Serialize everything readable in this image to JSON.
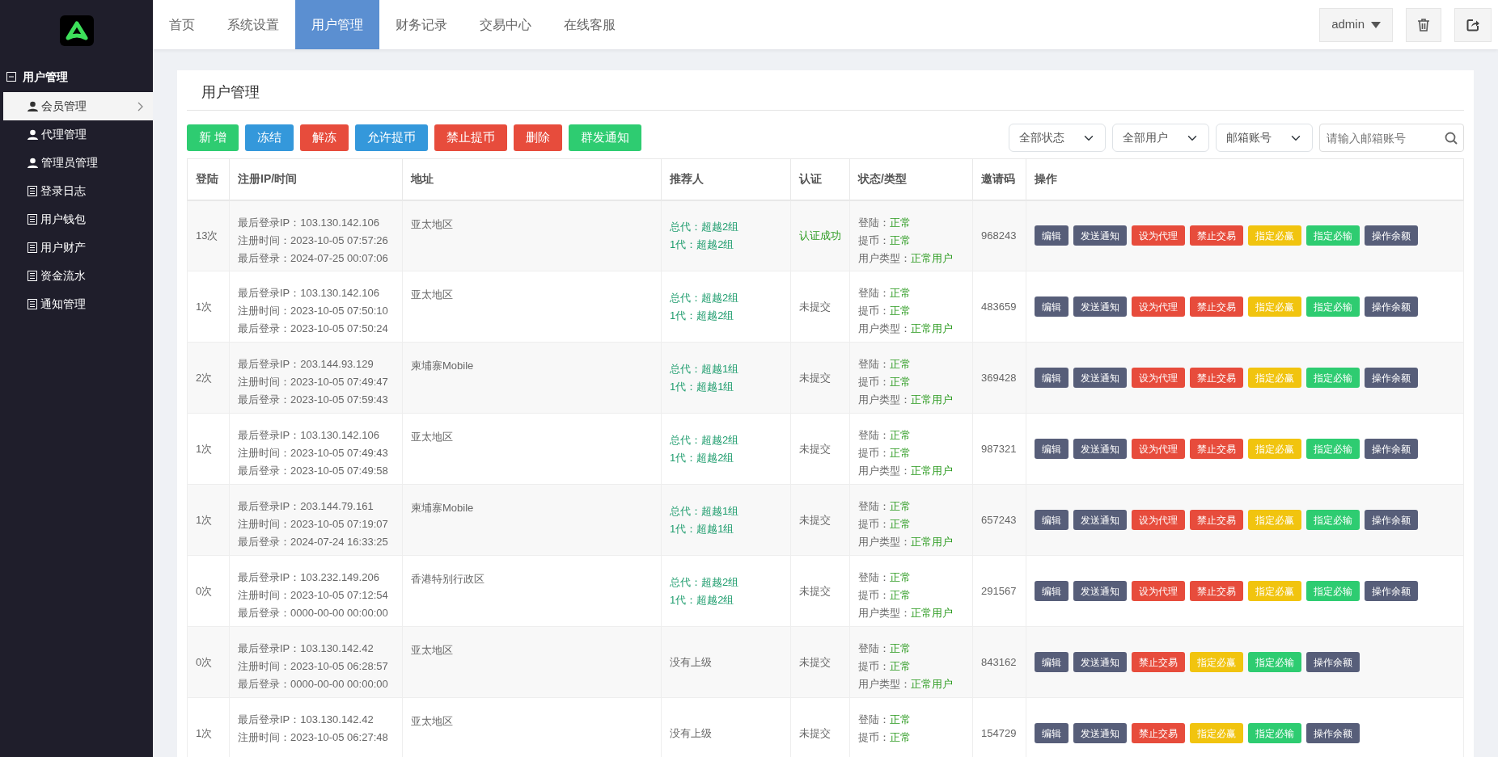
{
  "sidebar": {
    "group": {
      "label": "用户管理",
      "expanded": true
    },
    "items": [
      {
        "label": "会员管理",
        "kind": "user",
        "selected": true
      },
      {
        "label": "代理管理",
        "kind": "user",
        "selected": false
      },
      {
        "label": "管理员管理",
        "kind": "user",
        "selected": false
      },
      {
        "label": "登录日志",
        "kind": "list",
        "selected": false
      },
      {
        "label": "用户钱包",
        "kind": "list",
        "selected": false
      },
      {
        "label": "用户财产",
        "kind": "list",
        "selected": false
      },
      {
        "label": "资金流水",
        "kind": "list",
        "selected": false
      },
      {
        "label": "通知管理",
        "kind": "list",
        "selected": false
      }
    ]
  },
  "tabs": [
    {
      "label": "首页",
      "selected": false
    },
    {
      "label": "系统设置",
      "selected": false
    },
    {
      "label": "用户管理",
      "selected": true
    },
    {
      "label": "财务记录",
      "selected": false
    },
    {
      "label": "交易中心",
      "selected": false
    },
    {
      "label": "在线客服",
      "selected": false
    }
  ],
  "user_menu": {
    "label": "admin"
  },
  "panel": {
    "title": "用户管理",
    "toolbar": [
      {
        "label": "新 增",
        "kind": "success"
      },
      {
        "label": "冻结",
        "kind": "info"
      },
      {
        "label": "解冻",
        "kind": "danger"
      },
      {
        "label": "允许提币",
        "kind": "info"
      },
      {
        "label": "禁止提币",
        "kind": "danger"
      },
      {
        "label": "删除",
        "kind": "danger"
      },
      {
        "label": "群发通知",
        "kind": "success"
      }
    ],
    "filters": [
      {
        "value": "全部状态"
      },
      {
        "value": "全部用户"
      },
      {
        "value": "邮箱账号"
      }
    ],
    "search": {
      "placeholder": "请输入邮箱账号"
    },
    "table": {
      "columns": [
        "登陆",
        "注册IP/时间",
        "地址",
        "推荐人",
        "认证",
        "状态/类型",
        "邀请码",
        "操作"
      ],
      "rows": [
        {
          "logins": "13次",
          "info": [
            "最后登录IP：103.130.142.106",
            "注册时间：2023-10-05 07:57:26",
            "最后登录：2024-07-25 00:07:06"
          ],
          "address": "亚太地区",
          "referrer": {
            "kind": "linked",
            "lines": [
              "总代：超越2组",
              "1代：超越2组"
            ]
          },
          "verification": {
            "text": "认证成功",
            "verified": true
          },
          "status": [
            {
              "label": "登陆：",
              "value": "正常"
            },
            {
              "label": "提币：",
              "value": "正常"
            },
            {
              "label": "用户类型：",
              "value": "正常用户"
            }
          ],
          "invite_code": "968243",
          "actions": [
            {
              "label": "编辑",
              "kind": "dark"
            },
            {
              "label": "发送通知",
              "kind": "dark"
            },
            {
              "label": "设为代理",
              "kind": "red"
            },
            {
              "label": "禁止交易",
              "kind": "red"
            },
            {
              "label": "指定必赢",
              "kind": "yellow"
            },
            {
              "label": "指定必输",
              "kind": "green"
            },
            {
              "label": "操作余额",
              "kind": "dark"
            }
          ]
        },
        {
          "logins": "1次",
          "info": [
            "最后登录IP：103.130.142.106",
            "注册时间：2023-10-05 07:50:10",
            "最后登录：2023-10-05 07:50:24"
          ],
          "address": "亚太地区",
          "referrer": {
            "kind": "linked",
            "lines": [
              "总代：超越2组",
              "1代：超越2组"
            ]
          },
          "verification": {
            "text": "未提交",
            "verified": false
          },
          "status": [
            {
              "label": "登陆：",
              "value": "正常"
            },
            {
              "label": "提币：",
              "value": "正常"
            },
            {
              "label": "用户类型：",
              "value": "正常用户"
            }
          ],
          "invite_code": "483659",
          "actions": [
            {
              "label": "编辑",
              "kind": "dark"
            },
            {
              "label": "发送通知",
              "kind": "dark"
            },
            {
              "label": "设为代理",
              "kind": "red"
            },
            {
              "label": "禁止交易",
              "kind": "red"
            },
            {
              "label": "指定必赢",
              "kind": "yellow"
            },
            {
              "label": "指定必输",
              "kind": "green"
            },
            {
              "label": "操作余额",
              "kind": "dark"
            }
          ]
        },
        {
          "logins": "2次",
          "info": [
            "最后登录IP：203.144.93.129",
            "注册时间：2023-10-05 07:49:47",
            "最后登录：2023-10-05 07:59:43"
          ],
          "address": "柬埔寨Mobile",
          "referrer": {
            "kind": "linked",
            "lines": [
              "总代：超越1组",
              "1代：超越1组"
            ]
          },
          "verification": {
            "text": "未提交",
            "verified": false
          },
          "status": [
            {
              "label": "登陆：",
              "value": "正常"
            },
            {
              "label": "提币：",
              "value": "正常"
            },
            {
              "label": "用户类型：",
              "value": "正常用户"
            }
          ],
          "invite_code": "369428",
          "actions": [
            {
              "label": "编辑",
              "kind": "dark"
            },
            {
              "label": "发送通知",
              "kind": "dark"
            },
            {
              "label": "设为代理",
              "kind": "red"
            },
            {
              "label": "禁止交易",
              "kind": "red"
            },
            {
              "label": "指定必赢",
              "kind": "yellow"
            },
            {
              "label": "指定必输",
              "kind": "green"
            },
            {
              "label": "操作余额",
              "kind": "dark"
            }
          ]
        },
        {
          "logins": "1次",
          "info": [
            "最后登录IP：103.130.142.106",
            "注册时间：2023-10-05 07:49:43",
            "最后登录：2023-10-05 07:49:58"
          ],
          "address": "亚太地区",
          "referrer": {
            "kind": "linked",
            "lines": [
              "总代：超越2组",
              "1代：超越2组"
            ]
          },
          "verification": {
            "text": "未提交",
            "verified": false
          },
          "status": [
            {
              "label": "登陆：",
              "value": "正常"
            },
            {
              "label": "提币：",
              "value": "正常"
            },
            {
              "label": "用户类型：",
              "value": "正常用户"
            }
          ],
          "invite_code": "987321",
          "actions": [
            {
              "label": "编辑",
              "kind": "dark"
            },
            {
              "label": "发送通知",
              "kind": "dark"
            },
            {
              "label": "设为代理",
              "kind": "red"
            },
            {
              "label": "禁止交易",
              "kind": "red"
            },
            {
              "label": "指定必赢",
              "kind": "yellow"
            },
            {
              "label": "指定必输",
              "kind": "green"
            },
            {
              "label": "操作余额",
              "kind": "dark"
            }
          ]
        },
        {
          "logins": "1次",
          "info": [
            "最后登录IP：203.144.79.161",
            "注册时间：2023-10-05 07:19:07",
            "最后登录：2024-07-24 16:33:25"
          ],
          "address": "柬埔寨Mobile",
          "referrer": {
            "kind": "linked",
            "lines": [
              "总代：超越1组",
              "1代：超越1组"
            ]
          },
          "verification": {
            "text": "未提交",
            "verified": false
          },
          "status": [
            {
              "label": "登陆：",
              "value": "正常"
            },
            {
              "label": "提币：",
              "value": "正常"
            },
            {
              "label": "用户类型：",
              "value": "正常用户"
            }
          ],
          "invite_code": "657243",
          "actions": [
            {
              "label": "编辑",
              "kind": "dark"
            },
            {
              "label": "发送通知",
              "kind": "dark"
            },
            {
              "label": "设为代理",
              "kind": "red"
            },
            {
              "label": "禁止交易",
              "kind": "red"
            },
            {
              "label": "指定必赢",
              "kind": "yellow"
            },
            {
              "label": "指定必输",
              "kind": "green"
            },
            {
              "label": "操作余额",
              "kind": "dark"
            }
          ]
        },
        {
          "logins": "0次",
          "info": [
            "最后登录IP：103.232.149.206",
            "注册时间：2023-10-05 07:12:54",
            "最后登录：0000-00-00 00:00:00"
          ],
          "address": "香港特别行政区",
          "referrer": {
            "kind": "linked",
            "lines": [
              "总代：超越2组",
              "1代：超越2组"
            ]
          },
          "verification": {
            "text": "未提交",
            "verified": false
          },
          "status": [
            {
              "label": "登陆：",
              "value": "正常"
            },
            {
              "label": "提币：",
              "value": "正常"
            },
            {
              "label": "用户类型：",
              "value": "正常用户"
            }
          ],
          "invite_code": "291567",
          "actions": [
            {
              "label": "编辑",
              "kind": "dark"
            },
            {
              "label": "发送通知",
              "kind": "dark"
            },
            {
              "label": "设为代理",
              "kind": "red"
            },
            {
              "label": "禁止交易",
              "kind": "red"
            },
            {
              "label": "指定必赢",
              "kind": "yellow"
            },
            {
              "label": "指定必输",
              "kind": "green"
            },
            {
              "label": "操作余额",
              "kind": "dark"
            }
          ]
        },
        {
          "logins": "0次",
          "info": [
            "最后登录IP：103.130.142.42",
            "注册时间：2023-10-05 06:28:57",
            "最后登录：0000-00-00 00:00:00"
          ],
          "address": "亚太地区",
          "referrer": {
            "kind": "none",
            "lines": [
              "没有上级"
            ]
          },
          "verification": {
            "text": "未提交",
            "verified": false
          },
          "status": [
            {
              "label": "登陆：",
              "value": "正常"
            },
            {
              "label": "提币：",
              "value": "正常"
            },
            {
              "label": "用户类型：",
              "value": "正常用户"
            }
          ],
          "invite_code": "843162",
          "actions": [
            {
              "label": "编辑",
              "kind": "dark"
            },
            {
              "label": "发送通知",
              "kind": "dark"
            },
            {
              "label": "禁止交易",
              "kind": "red"
            },
            {
              "label": "指定必赢",
              "kind": "yellow"
            },
            {
              "label": "指定必输",
              "kind": "green"
            },
            {
              "label": "操作余额",
              "kind": "dark"
            }
          ]
        },
        {
          "logins": "1次",
          "info": [
            "最后登录IP：103.130.142.42",
            "注册时间：2023-10-05 06:27:48"
          ],
          "address": "亚太地区",
          "referrer": {
            "kind": "none",
            "lines": [
              "没有上级"
            ]
          },
          "verification": {
            "text": "未提交",
            "verified": false
          },
          "status": [
            {
              "label": "登陆：",
              "value": "正常"
            },
            {
              "label": "提币：",
              "value": "正常"
            }
          ],
          "invite_code": "154729",
          "actions": [
            {
              "label": "编辑",
              "kind": "dark"
            },
            {
              "label": "发送通知",
              "kind": "dark"
            },
            {
              "label": "禁止交易",
              "kind": "red"
            },
            {
              "label": "指定必赢",
              "kind": "yellow"
            },
            {
              "label": "指定必输",
              "kind": "green"
            },
            {
              "label": "操作余额",
              "kind": "dark"
            }
          ]
        }
      ]
    }
  }
}
